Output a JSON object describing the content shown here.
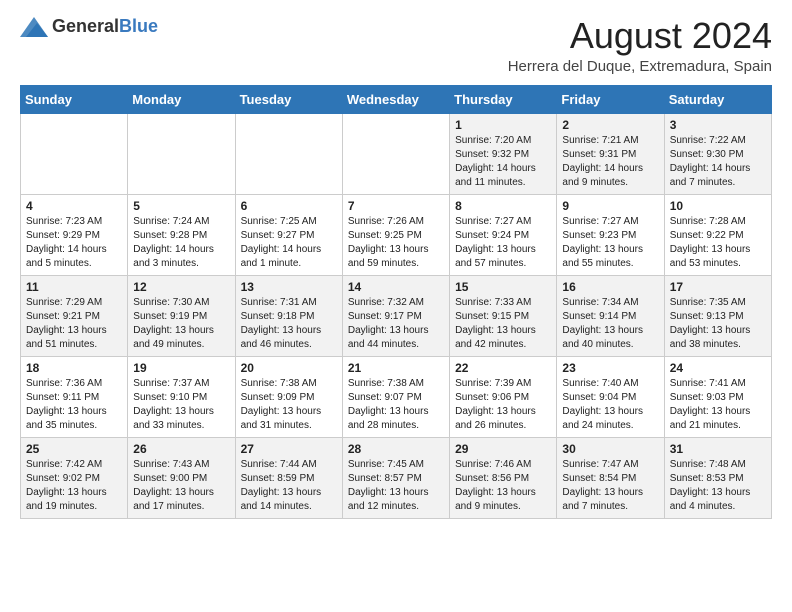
{
  "header": {
    "logo_general": "General",
    "logo_blue": "Blue",
    "title": "August 2024",
    "location": "Herrera del Duque, Extremadura, Spain"
  },
  "weekdays": [
    "Sunday",
    "Monday",
    "Tuesday",
    "Wednesday",
    "Thursday",
    "Friday",
    "Saturday"
  ],
  "weeks": [
    [
      {
        "day": "",
        "info": ""
      },
      {
        "day": "",
        "info": ""
      },
      {
        "day": "",
        "info": ""
      },
      {
        "day": "",
        "info": ""
      },
      {
        "day": "1",
        "info": "Sunrise: 7:20 AM\nSunset: 9:32 PM\nDaylight: 14 hours\nand 11 minutes."
      },
      {
        "day": "2",
        "info": "Sunrise: 7:21 AM\nSunset: 9:31 PM\nDaylight: 14 hours\nand 9 minutes."
      },
      {
        "day": "3",
        "info": "Sunrise: 7:22 AM\nSunset: 9:30 PM\nDaylight: 14 hours\nand 7 minutes."
      }
    ],
    [
      {
        "day": "4",
        "info": "Sunrise: 7:23 AM\nSunset: 9:29 PM\nDaylight: 14 hours\nand 5 minutes."
      },
      {
        "day": "5",
        "info": "Sunrise: 7:24 AM\nSunset: 9:28 PM\nDaylight: 14 hours\nand 3 minutes."
      },
      {
        "day": "6",
        "info": "Sunrise: 7:25 AM\nSunset: 9:27 PM\nDaylight: 14 hours\nand 1 minute."
      },
      {
        "day": "7",
        "info": "Sunrise: 7:26 AM\nSunset: 9:25 PM\nDaylight: 13 hours\nand 59 minutes."
      },
      {
        "day": "8",
        "info": "Sunrise: 7:27 AM\nSunset: 9:24 PM\nDaylight: 13 hours\nand 57 minutes."
      },
      {
        "day": "9",
        "info": "Sunrise: 7:27 AM\nSunset: 9:23 PM\nDaylight: 13 hours\nand 55 minutes."
      },
      {
        "day": "10",
        "info": "Sunrise: 7:28 AM\nSunset: 9:22 PM\nDaylight: 13 hours\nand 53 minutes."
      }
    ],
    [
      {
        "day": "11",
        "info": "Sunrise: 7:29 AM\nSunset: 9:21 PM\nDaylight: 13 hours\nand 51 minutes."
      },
      {
        "day": "12",
        "info": "Sunrise: 7:30 AM\nSunset: 9:19 PM\nDaylight: 13 hours\nand 49 minutes."
      },
      {
        "day": "13",
        "info": "Sunrise: 7:31 AM\nSunset: 9:18 PM\nDaylight: 13 hours\nand 46 minutes."
      },
      {
        "day": "14",
        "info": "Sunrise: 7:32 AM\nSunset: 9:17 PM\nDaylight: 13 hours\nand 44 minutes."
      },
      {
        "day": "15",
        "info": "Sunrise: 7:33 AM\nSunset: 9:15 PM\nDaylight: 13 hours\nand 42 minutes."
      },
      {
        "day": "16",
        "info": "Sunrise: 7:34 AM\nSunset: 9:14 PM\nDaylight: 13 hours\nand 40 minutes."
      },
      {
        "day": "17",
        "info": "Sunrise: 7:35 AM\nSunset: 9:13 PM\nDaylight: 13 hours\nand 38 minutes."
      }
    ],
    [
      {
        "day": "18",
        "info": "Sunrise: 7:36 AM\nSunset: 9:11 PM\nDaylight: 13 hours\nand 35 minutes."
      },
      {
        "day": "19",
        "info": "Sunrise: 7:37 AM\nSunset: 9:10 PM\nDaylight: 13 hours\nand 33 minutes."
      },
      {
        "day": "20",
        "info": "Sunrise: 7:38 AM\nSunset: 9:09 PM\nDaylight: 13 hours\nand 31 minutes."
      },
      {
        "day": "21",
        "info": "Sunrise: 7:38 AM\nSunset: 9:07 PM\nDaylight: 13 hours\nand 28 minutes."
      },
      {
        "day": "22",
        "info": "Sunrise: 7:39 AM\nSunset: 9:06 PM\nDaylight: 13 hours\nand 26 minutes."
      },
      {
        "day": "23",
        "info": "Sunrise: 7:40 AM\nSunset: 9:04 PM\nDaylight: 13 hours\nand 24 minutes."
      },
      {
        "day": "24",
        "info": "Sunrise: 7:41 AM\nSunset: 9:03 PM\nDaylight: 13 hours\nand 21 minutes."
      }
    ],
    [
      {
        "day": "25",
        "info": "Sunrise: 7:42 AM\nSunset: 9:02 PM\nDaylight: 13 hours\nand 19 minutes."
      },
      {
        "day": "26",
        "info": "Sunrise: 7:43 AM\nSunset: 9:00 PM\nDaylight: 13 hours\nand 17 minutes."
      },
      {
        "day": "27",
        "info": "Sunrise: 7:44 AM\nSunset: 8:59 PM\nDaylight: 13 hours\nand 14 minutes."
      },
      {
        "day": "28",
        "info": "Sunrise: 7:45 AM\nSunset: 8:57 PM\nDaylight: 13 hours\nand 12 minutes."
      },
      {
        "day": "29",
        "info": "Sunrise: 7:46 AM\nSunset: 8:56 PM\nDaylight: 13 hours\nand 9 minutes."
      },
      {
        "day": "30",
        "info": "Sunrise: 7:47 AM\nSunset: 8:54 PM\nDaylight: 13 hours\nand 7 minutes."
      },
      {
        "day": "31",
        "info": "Sunrise: 7:48 AM\nSunset: 8:53 PM\nDaylight: 13 hours\nand 4 minutes."
      }
    ]
  ]
}
